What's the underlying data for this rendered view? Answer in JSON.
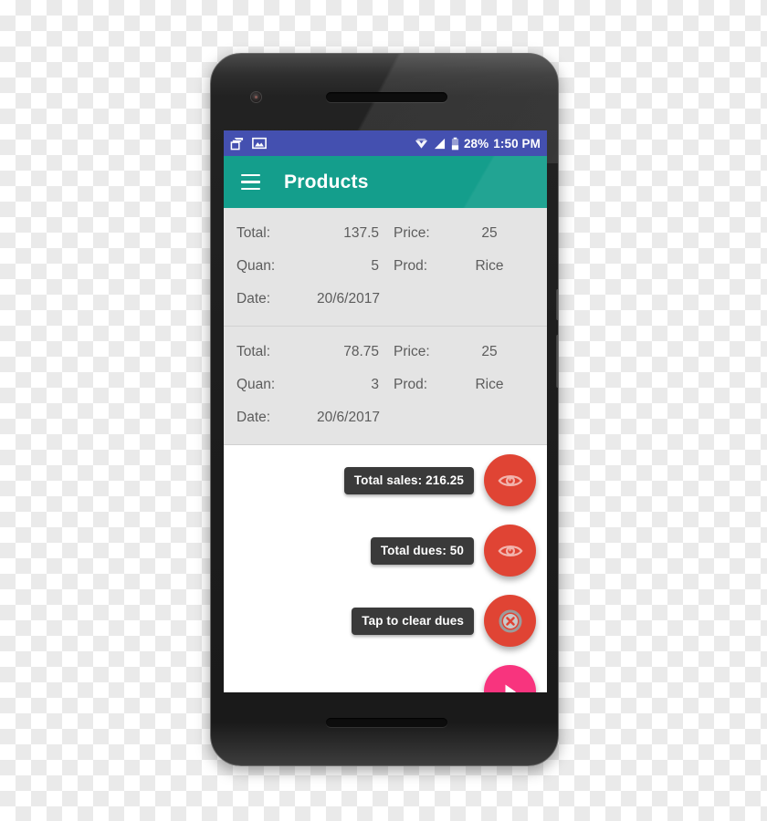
{
  "device": {
    "frame_name": "android-smartphone",
    "body_color": "#1d1d1d"
  },
  "status_bar": {
    "background": "#4450b0",
    "left_icons": [
      "copy-stack-icon",
      "photo-image-icon"
    ],
    "right_icons": [
      "wifi-diamond-icon",
      "signal-bars-icon",
      "battery-icon"
    ],
    "battery_percent": "28%",
    "time": "1:50 PM"
  },
  "app_bar": {
    "background": "#149e8c",
    "menu_icon": "hamburger-menu-icon",
    "title": "Products"
  },
  "product_list": {
    "labels": {
      "total": "Total:",
      "price": "Price:",
      "quan": "Quan:",
      "prod": "Prod:",
      "date": "Date:"
    },
    "rows": [
      {
        "total": "137.5",
        "price": "25",
        "quan": "5",
        "prod": "Rice",
        "date": "20/6/2017"
      },
      {
        "total": "78.75",
        "price": "25",
        "quan": "3",
        "prod": "Rice",
        "date": "20/6/2017"
      }
    ]
  },
  "actions": [
    {
      "tooltip": "Total sales: 216.25",
      "icon": "eye-icon",
      "color": "#e04434"
    },
    {
      "tooltip": "Total dues: 50",
      "icon": "eye-icon",
      "color": "#e04434"
    },
    {
      "tooltip": "Tap to clear dues",
      "icon": "close-circle-icon",
      "color": "#e04434"
    },
    {
      "tooltip": "",
      "icon": "play-cursor-icon",
      "color": "#f8347e"
    }
  ]
}
